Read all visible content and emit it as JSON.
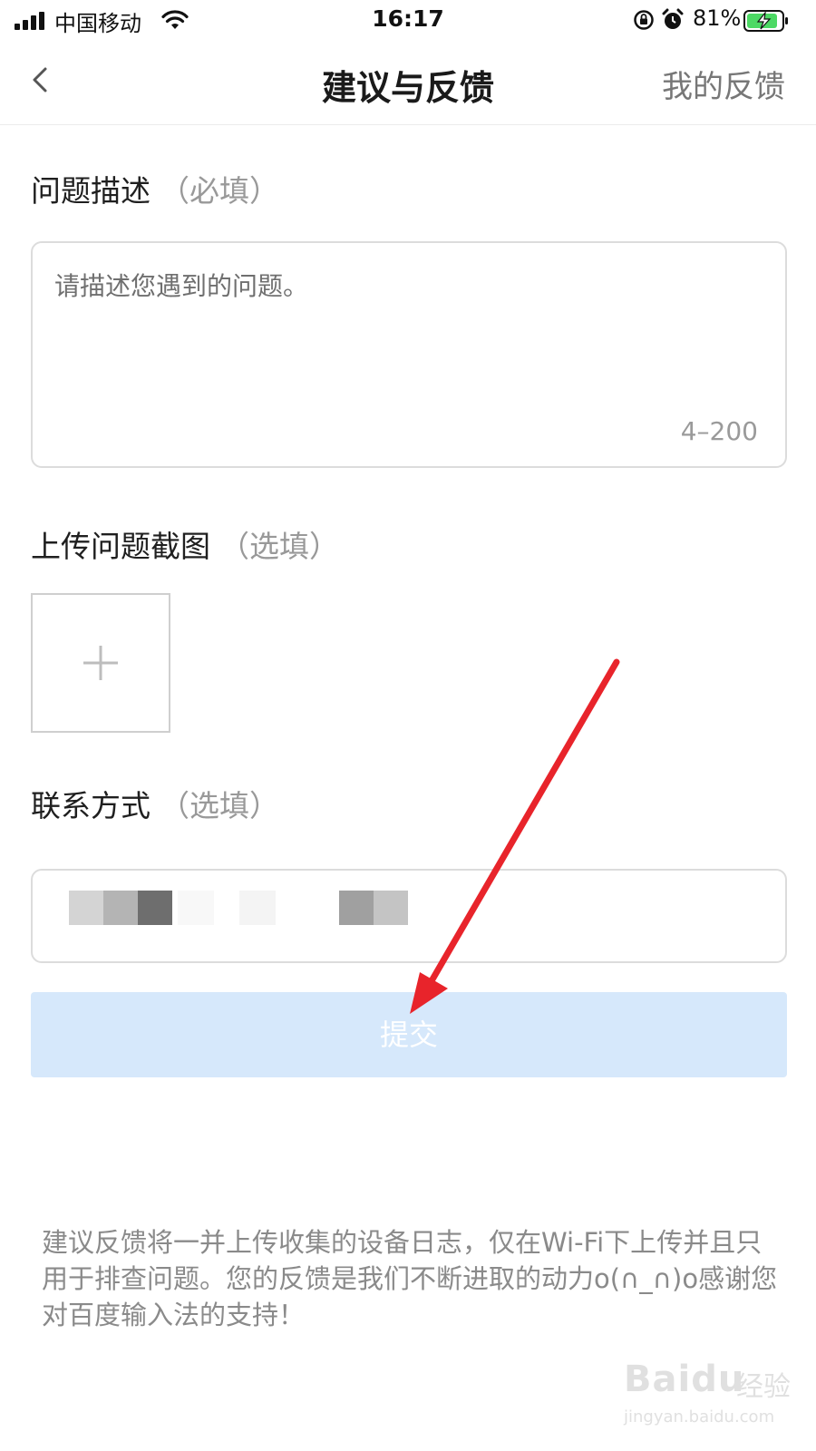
{
  "status_bar": {
    "carrier": "中国移动",
    "time": "16:17",
    "battery_percent": "81%",
    "icons": [
      "signal-icon",
      "wifi-icon",
      "rotation-lock-icon",
      "alarm-icon",
      "battery-charging-icon"
    ]
  },
  "nav": {
    "title": "建议与反馈",
    "right_link": "我的反馈",
    "back_icon": "chevron-left-icon"
  },
  "description": {
    "title": "问题描述",
    "hint": "（必填）",
    "placeholder": "请描述您遇到的问题。",
    "char_limit": "4–200"
  },
  "screenshot": {
    "title": "上传问题截图",
    "hint": "（选填）",
    "add_icon": "plus-icon"
  },
  "contact": {
    "title": "联系方式",
    "hint": "（选填）"
  },
  "submit": {
    "label": "提交",
    "color": "#d6e8fb"
  },
  "footer_note": "建议反馈将一并上传收集的设备日志，仅在Wi-Fi下上传并且只用于排查问题。您的反馈是我们不断进取的动力o(∩_∩)o感谢您对百度输入法的支持！",
  "annotation": {
    "arrow_color": "#e8242b"
  },
  "watermark": {
    "logo": "Baidu",
    "logo_cn": "经验",
    "url": "jingyan.baidu.com"
  }
}
